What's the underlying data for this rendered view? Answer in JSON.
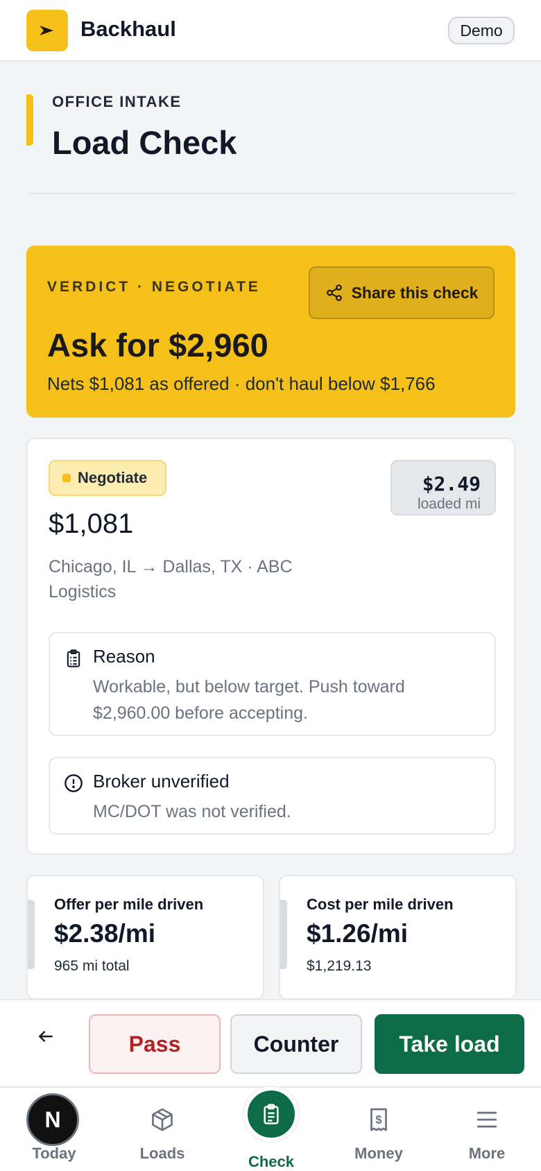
{
  "header": {
    "app_name": "Backhaul",
    "demo_label": "Demo",
    "logo_icon": "arrow-right-icon"
  },
  "page": {
    "eyebrow": "OFFICE INTAKE",
    "title": "Load Check"
  },
  "verdict": {
    "label": "VERDICT · NEGOTIATE",
    "share_label": "Share this check",
    "ask": "Ask for $2,960",
    "nets": "Nets $1,081 as offered · don't haul below $1,766"
  },
  "summary": {
    "status": "Negotiate",
    "amount": "$1,081",
    "rate": "$2.49",
    "rate_unit": "loaded mi",
    "route": "Chicago, IL → Dallas, TX · ABC Logistics",
    "reason_title": "Reason",
    "reason_body": "Workable, but below target. Push toward $2,960.00 before accepting.",
    "broker_title": "Broker unverified",
    "broker_body": "MC/DOT was not verified."
  },
  "stats": [
    {
      "label": "Offer per mile driven",
      "value": "$2.38/mi",
      "sub": "965 mi total"
    },
    {
      "label": "Cost per mile driven",
      "value": "$1.26/mi",
      "sub": "$1,219.13"
    }
  ],
  "actions": {
    "pass": "Pass",
    "counter": "Counter",
    "take": "Take load"
  },
  "nav": {
    "today": "Today",
    "loads": "Loads",
    "check": "Check",
    "money": "Money",
    "more": "More",
    "avatar_letter": "N"
  },
  "colors": {
    "brand_yellow": "#f5c01a",
    "primary_green": "#0d6b47",
    "pass_red": "#b42323"
  }
}
